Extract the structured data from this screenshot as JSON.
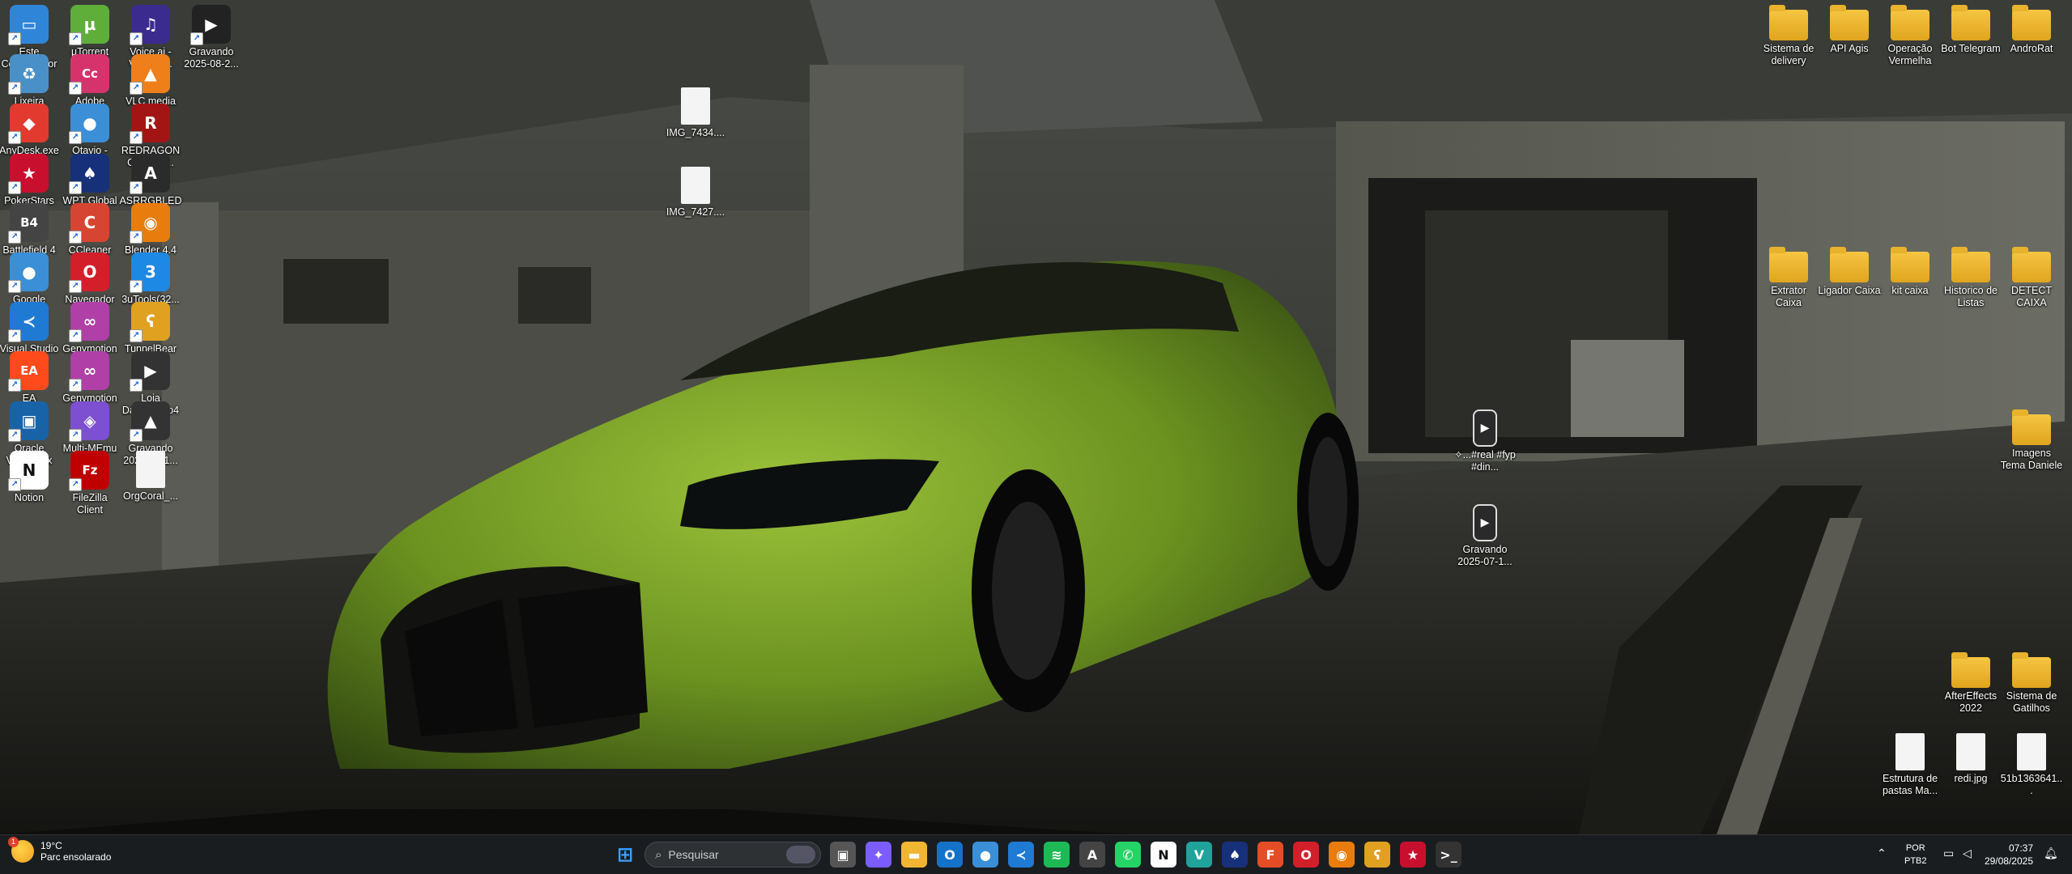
{
  "desktop": {
    "icons_left": [
      {
        "label": "Este Computador",
        "icon": "monitor-icon",
        "color": "#2f86d9",
        "glyph": "▭"
      },
      {
        "label": "µTorrent",
        "icon": "utorrent-icon",
        "color": "#5fae3a",
        "glyph": "µ"
      },
      {
        "label": "Voice.ai - Voice C...",
        "icon": "voiceai-icon",
        "color": "#3c2b8f",
        "glyph": "♫"
      },
      {
        "label": "Gravando 2025-08-2...",
        "icon": "video-file-icon",
        "color": "#222",
        "glyph": "▶"
      },
      {
        "label": "Lixeira",
        "icon": "recycle-bin-icon",
        "color": "#4a90c8",
        "glyph": "♻"
      },
      {
        "label": "Adobe Creati...",
        "icon": "adobe-cc-icon",
        "color": "#d6336c",
        "glyph": "Cc"
      },
      {
        "label": "VLC media player",
        "icon": "vlc-icon",
        "color": "#ef7f1a",
        "glyph": "▲"
      },
      {
        "label": "AnyDesk.exe",
        "icon": "anydesk-icon",
        "color": "#e23a2e",
        "glyph": "◆"
      },
      {
        "label": "Otavio - Chrome",
        "icon": "chrome-icon",
        "color": "#3a8fd6",
        "glyph": "●"
      },
      {
        "label": "REDRAGON Gaming ...",
        "icon": "redragon-icon",
        "color": "#a31515",
        "glyph": "R"
      },
      {
        "label": "PokerStars",
        "icon": "pokerstars-icon",
        "color": "#c8102e",
        "glyph": "★"
      },
      {
        "label": "WPT Global",
        "icon": "wpt-icon",
        "color": "#16307a",
        "glyph": "♠"
      },
      {
        "label": "ASRRGBLED",
        "icon": "asrock-icon",
        "color": "#2b2b2b",
        "glyph": "A"
      },
      {
        "label": "Battlefield 4",
        "icon": "battlefield-icon",
        "color": "#444",
        "glyph": "B4"
      },
      {
        "label": "CCleaner",
        "icon": "ccleaner-icon",
        "color": "#d64531",
        "glyph": "C"
      },
      {
        "label": "Blender 4.4",
        "icon": "blender-icon",
        "color": "#e87d0d",
        "glyph": "◉"
      },
      {
        "label": "Google Chrome",
        "icon": "chrome-icon",
        "color": "#3a8fd6",
        "glyph": "●"
      },
      {
        "label": "Navegador Opera",
        "icon": "opera-icon",
        "color": "#d21f2a",
        "glyph": "O"
      },
      {
        "label": "3uTools(32...",
        "icon": "3utools-icon",
        "color": "#1e88e5",
        "glyph": "3"
      },
      {
        "label": "Visual Studio Code",
        "icon": "vscode-icon",
        "color": "#1f7ad4",
        "glyph": "≺"
      },
      {
        "label": "Genymotion",
        "icon": "genymotion-icon",
        "color": "#b03fa8",
        "glyph": "∞"
      },
      {
        "label": "TunnelBear",
        "icon": "tunnelbear-icon",
        "color": "#e0a020",
        "glyph": "ʕ"
      },
      {
        "label": "EA",
        "icon": "ea-icon",
        "color": "#ff4a1c",
        "glyph": "EA"
      },
      {
        "label": "Genymotion Shell",
        "icon": "genymotion-icon",
        "color": "#b03fa8",
        "glyph": "∞"
      },
      {
        "label": "Loja Daniele.mp4",
        "icon": "video-file-icon",
        "color": "#333",
        "glyph": "▶"
      },
      {
        "label": "Oracle VirtualBox",
        "icon": "virtualbox-icon",
        "color": "#1863a8",
        "glyph": "▣"
      },
      {
        "label": "Multi-MEmu",
        "icon": "memu-icon",
        "color": "#7d4fd1",
        "glyph": "◈"
      },
      {
        "label": "Gravando 2025-08-1...",
        "icon": "vlc-icon",
        "color": "#333",
        "glyph": "▲"
      },
      {
        "label": "Notion",
        "icon": "notion-icon",
        "color": "#ffffff",
        "glyph": "N"
      },
      {
        "label": "FileZilla Client",
        "icon": "filezilla-icon",
        "color": "#bf0000",
        "glyph": "Fz"
      },
      {
        "label": "OrgCoral_...",
        "icon": "document-file-icon",
        "color": "#f4f4f4",
        "glyph": ""
      }
    ],
    "icons_middle": [
      {
        "label": "IMG_7434....",
        "icon": "image-file-icon"
      },
      {
        "label": "IMG_7427....",
        "icon": "image-file-icon"
      },
      {
        "label": "✧...#real #fyp #din...",
        "icon": "video-file-icon"
      },
      {
        "label": "Gravando 2025-07-1...",
        "icon": "video-file-icon"
      }
    ],
    "icons_right": [
      {
        "label": "Sistema de delivery",
        "icon": "folder-icon"
      },
      {
        "label": "API Agis",
        "icon": "folder-icon"
      },
      {
        "label": "Operação Vermelha",
        "icon": "folder-icon"
      },
      {
        "label": "Bot Telegram",
        "icon": "folder-icon"
      },
      {
        "label": "AndroRat",
        "icon": "folder-icon"
      },
      {
        "label": "Extrator Caixa",
        "icon": "folder-icon"
      },
      {
        "label": "Ligador Caixa",
        "icon": "folder-icon"
      },
      {
        "label": "kit caixa",
        "icon": "folder-icon"
      },
      {
        "label": "Historico de Listas",
        "icon": "folder-icon"
      },
      {
        "label": "DETECT CAIXA",
        "icon": "folder-icon"
      },
      {
        "label": "Imagens Tema Daniele",
        "icon": "folder-icon"
      },
      {
        "label": "AfterEffects 2022",
        "icon": "folder-icon"
      },
      {
        "label": "Sistema de Gatilhos",
        "icon": "folder-icon"
      },
      {
        "label": "Estrutura de pastas Ma...",
        "icon": "document-file-icon"
      },
      {
        "label": "redi.jpg",
        "icon": "image-file-icon"
      },
      {
        "label": "51b1363641...",
        "icon": "image-file-icon"
      }
    ]
  },
  "taskbar": {
    "weather": {
      "temp": "19°C",
      "condition": "Parc ensolarado",
      "badge": "1"
    },
    "search_placeholder": "Pesquisar",
    "language": {
      "line1": "POR",
      "line2": "PTB2"
    },
    "clock": {
      "time": "07:37",
      "date": "29/08/2025"
    },
    "apps": [
      {
        "name": "windows-start-icon",
        "color": "#3aa0ff",
        "glyph": "⊞"
      },
      {
        "name": "task-view-icon",
        "color": "#555",
        "glyph": "▣"
      },
      {
        "name": "copilot-icon",
        "color": "#7a5cff",
        "glyph": "✦"
      },
      {
        "name": "file-explorer-icon",
        "color": "#f0b632",
        "glyph": "▬"
      },
      {
        "name": "outlook-icon",
        "color": "#1572c9",
        "glyph": "O"
      },
      {
        "name": "chrome-icon",
        "color": "#3a8fd6",
        "glyph": "●"
      },
      {
        "name": "vscode-icon",
        "color": "#1f7ad4",
        "glyph": "≺"
      },
      {
        "name": "spotify-icon",
        "color": "#1db954",
        "glyph": "≋"
      },
      {
        "name": "app-store-icon",
        "color": "#444",
        "glyph": "A"
      },
      {
        "name": "whatsapp-icon",
        "color": "#25d366",
        "glyph": "✆"
      },
      {
        "name": "notion-icon",
        "color": "#ffffff",
        "glyph": "N"
      },
      {
        "name": "visual-studio-icon",
        "color": "#1fa39b",
        "glyph": "V"
      },
      {
        "name": "wpt-icon",
        "color": "#16307a",
        "glyph": "♠"
      },
      {
        "name": "figma-icon",
        "color": "#e44d26",
        "glyph": "F"
      },
      {
        "name": "opera-icon",
        "color": "#d21f2a",
        "glyph": "O"
      },
      {
        "name": "blender-icon",
        "color": "#e87d0d",
        "glyph": "◉"
      },
      {
        "name": "tunnelbear-icon",
        "color": "#e0a020",
        "glyph": "ʕ"
      },
      {
        "name": "pokerstars-icon",
        "color": "#c8102e",
        "glyph": "★"
      },
      {
        "name": "terminal-icon",
        "color": "#333",
        "glyph": ">_"
      }
    ]
  }
}
